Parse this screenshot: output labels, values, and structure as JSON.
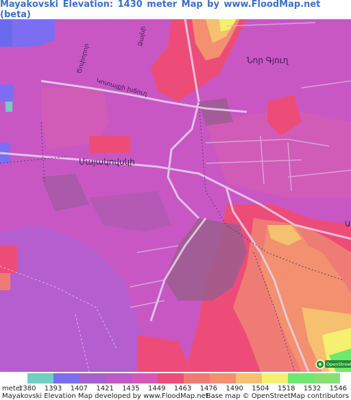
{
  "title": "Mayakovski Elevation: 1430 meter Map by www.FloodMap.net (beta)",
  "map_labels": {
    "city": "Մայակովսկի",
    "nor_gyugh": "Նոր Գյուղ",
    "street_1": "Ծոփորոր",
    "street_2": "Կոտայքի խճուղ",
    "street_3": "Ձայնի",
    "street_right": "Ա",
    "osm_badge": "OpenStreetMap"
  },
  "legend": {
    "unit_label": "meter",
    "ticks": [
      "1380",
      "1393",
      "1407",
      "1421",
      "1435",
      "1449",
      "1463",
      "1476",
      "1490",
      "1504",
      "1518",
      "1532",
      "1546"
    ],
    "colors": [
      "#ffffff",
      "#6fd0c0",
      "#7a6ef0",
      "#a860d0",
      "#c058c8",
      "#d458b8",
      "#ee4c78",
      "#ef7c74",
      "#f29070",
      "#f5c070",
      "#f5f070",
      "#6ee86e",
      "#88e070"
    ]
  },
  "footer": {
    "left": "Mayakovski Elevation Map developed by www.FloodMap.net",
    "right": "Base map © OpenStreetMap contributors"
  }
}
